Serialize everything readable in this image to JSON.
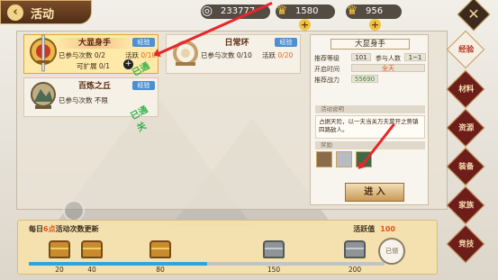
{
  "header": {
    "title": "活动",
    "back_glyph": "‹",
    "close_glyph": "✕"
  },
  "resources": [
    {
      "icon": "silver-coin-icon",
      "value": "233777"
    },
    {
      "icon": "gold-ingot-icon",
      "value": "1580"
    },
    {
      "icon": "gold-bar-icon",
      "value": "956"
    }
  ],
  "activities": [
    {
      "name": "大显身手",
      "tag": "经验",
      "line1_label": "已参与次数",
      "line1_value": "0/2",
      "line1b_label": "活跃",
      "line1b_value": "0/10",
      "line2_label": "可扩展",
      "line2_value": "0/1",
      "stamp": "已通关"
    },
    {
      "name": "日常环",
      "tag": "经验",
      "line1_label": "已参与次数",
      "line1_value": "0/10",
      "line1b_label": "活跃",
      "line1b_value": "0/20"
    },
    {
      "name": "百炼之丘",
      "tag": "经验",
      "line1_label": "已参与次数",
      "line1_value": "不限",
      "stamp": "已通关"
    }
  ],
  "detail": {
    "title": "大显身手",
    "recommend_level_label": "推荐等级",
    "recommend_level": "101",
    "participants_label": "参与人数",
    "participants": "1~1",
    "open_time_label": "开启时间",
    "open_time": "全天",
    "recommend_power_label": "推荐战力",
    "recommend_power": "55690",
    "desc_section": "活动说明",
    "description": "占据天险，以一夫当关万夫莫开之势镇四路敌人。",
    "reward_section": "奖励",
    "enter_label": "进 入"
  },
  "side_tabs": [
    {
      "label": "经验",
      "selected": true
    },
    {
      "label": "材料",
      "selected": false
    },
    {
      "label": "资源",
      "selected": false
    },
    {
      "label": "装备",
      "selected": false
    },
    {
      "label": "家族",
      "selected": false
    },
    {
      "label": "竞技",
      "selected": false
    }
  ],
  "bottom": {
    "daily_prefix": "每日",
    "daily_hour": "6点",
    "daily_suffix": "活动次数更新",
    "activity_label": "活跃值",
    "activity_value": "100",
    "milestones": [
      "20",
      "40",
      "80",
      "150",
      "200"
    ],
    "final_badge": "已领",
    "progress_fraction": 0.5
  },
  "colors": {
    "accent_orange": "#e0561a",
    "tag_blue": "#4d8fd1",
    "stamp_green": "#2fb34a",
    "arrow_red": "#e9262a"
  }
}
